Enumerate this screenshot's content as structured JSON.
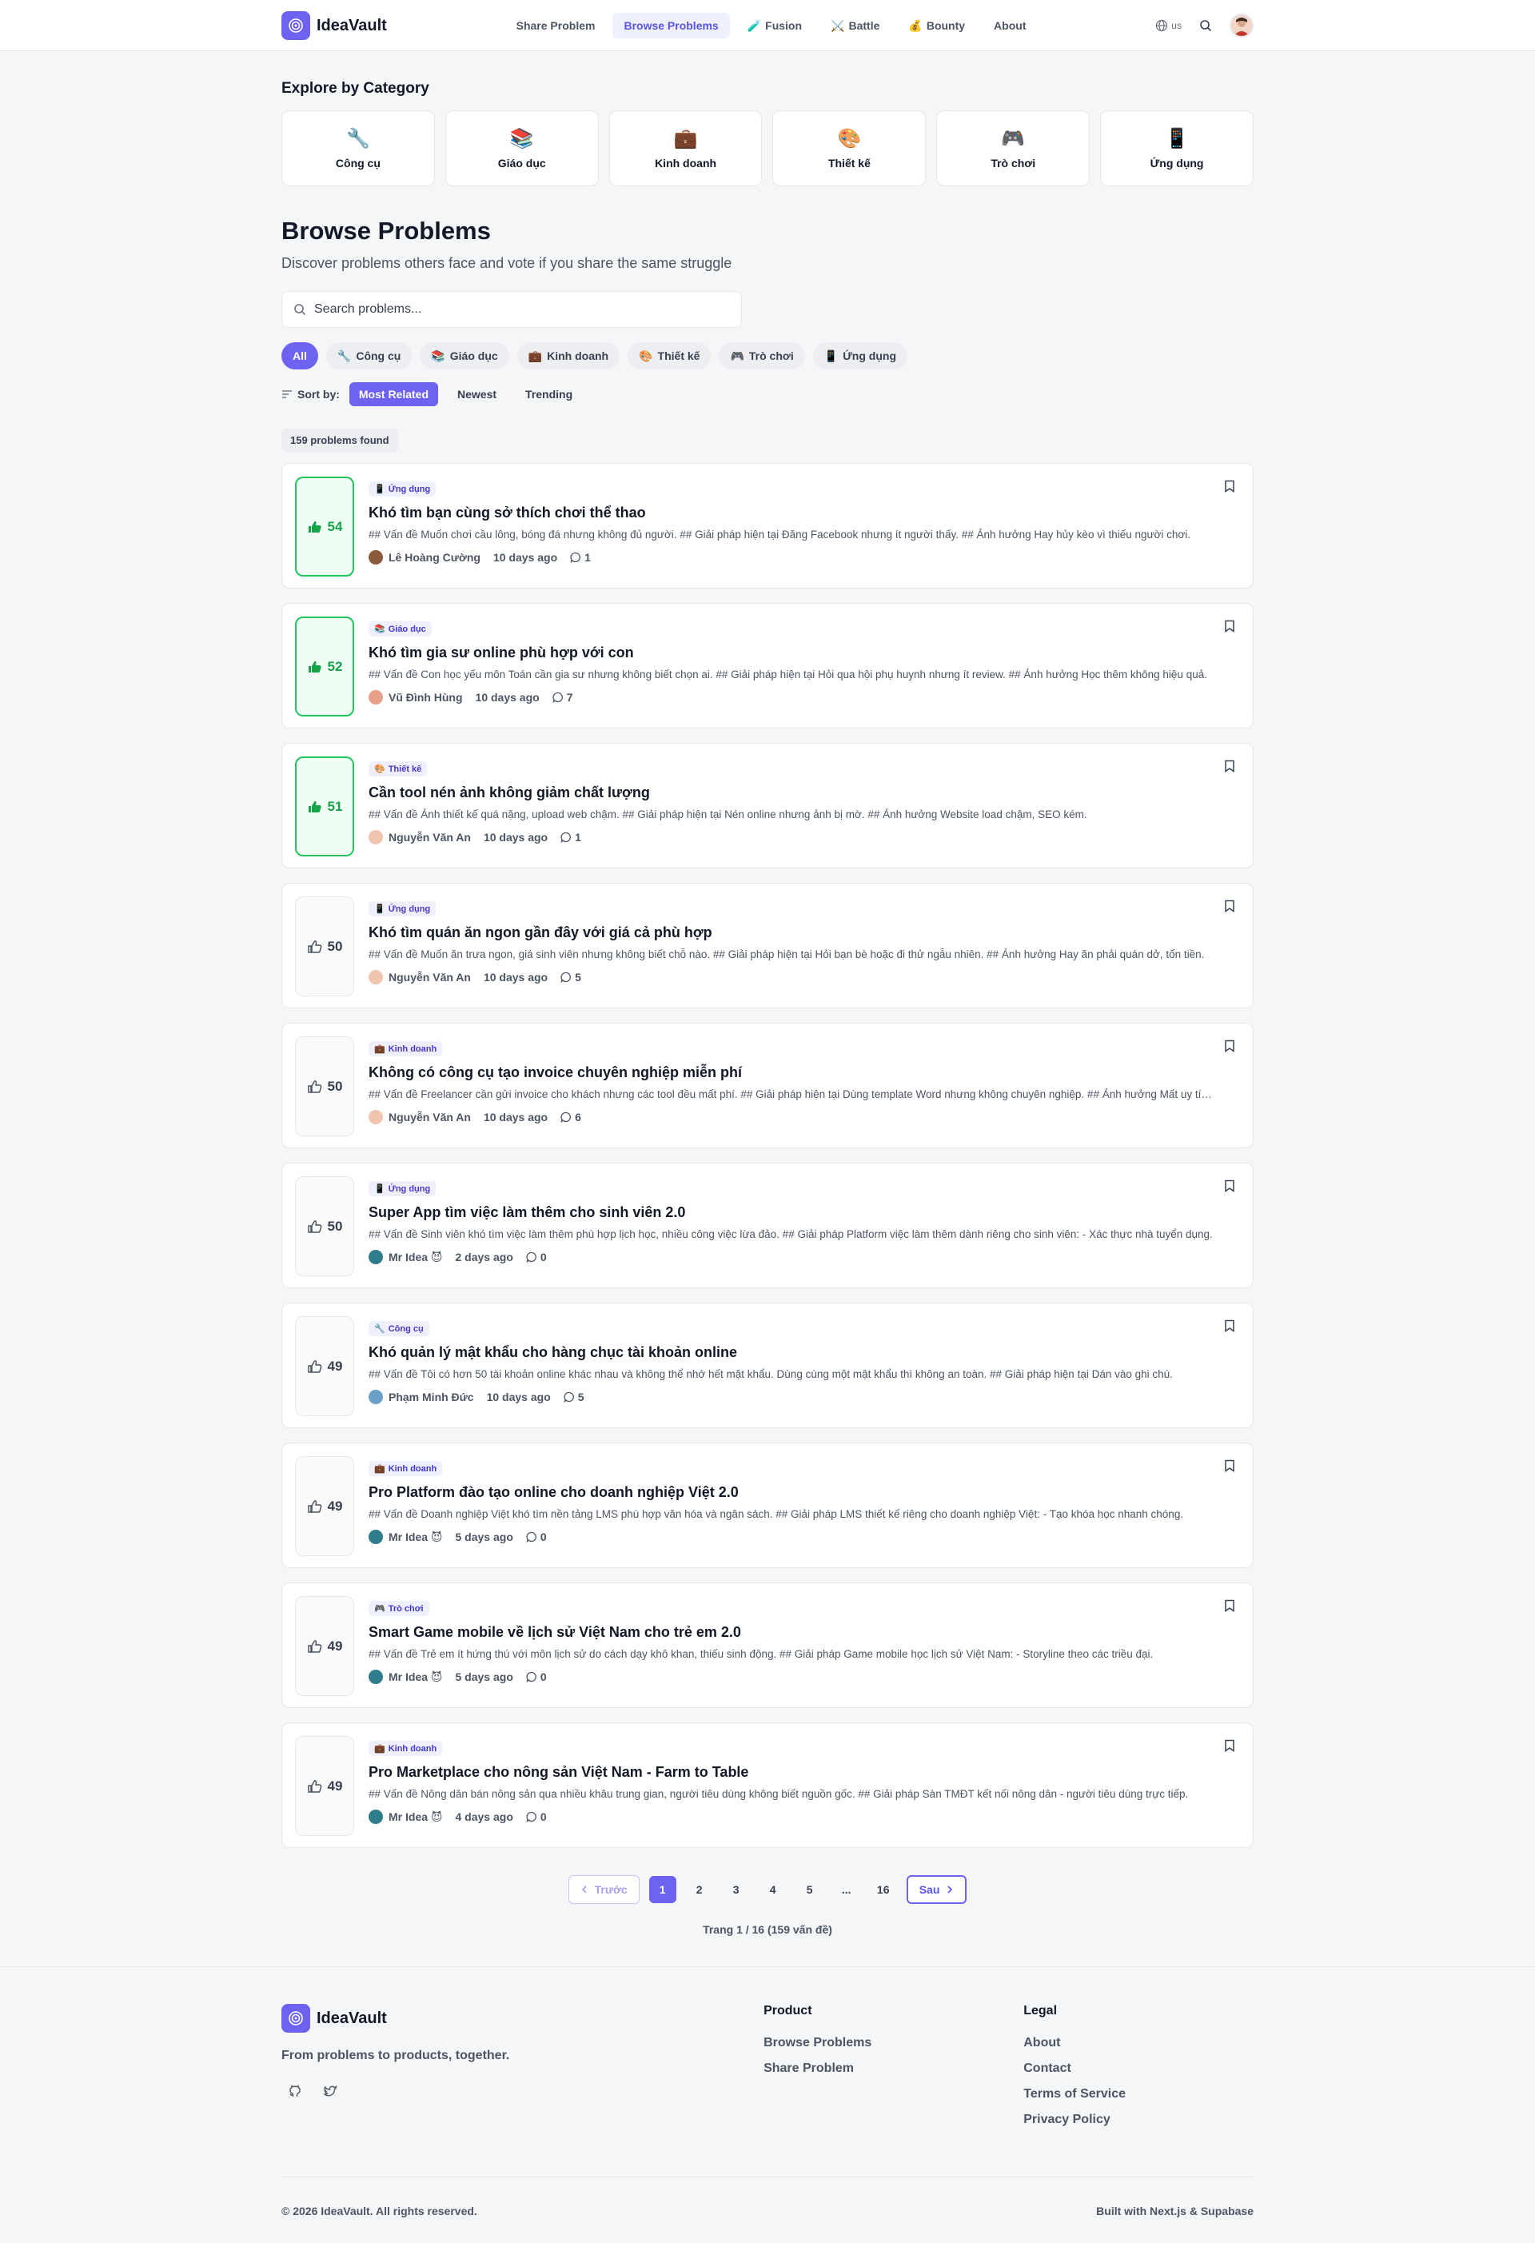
{
  "header": {
    "brand": "IdeaVault",
    "nav": [
      {
        "label": "Share Problem",
        "icon": ""
      },
      {
        "label": "Browse Problems",
        "icon": ""
      },
      {
        "label": "Fusion",
        "icon": "🧪"
      },
      {
        "label": "Battle",
        "icon": "⚔️"
      },
      {
        "label": "Bounty",
        "icon": "💰"
      },
      {
        "label": "About",
        "icon": ""
      }
    ],
    "lang": "us"
  },
  "categories_section": {
    "title": "Explore by Category",
    "items": [
      {
        "label": "Công cụ",
        "icon": "🔧"
      },
      {
        "label": "Giáo dục",
        "icon": "📚"
      },
      {
        "label": "Kinh doanh",
        "icon": "💼"
      },
      {
        "label": "Thiết kế",
        "icon": "🎨"
      },
      {
        "label": "Trò chơi",
        "icon": "🎮"
      },
      {
        "label": "Ứng dụng",
        "icon": "📱"
      }
    ]
  },
  "main": {
    "title": "Browse Problems",
    "subtitle": "Discover problems others face and vote if you share the same struggle",
    "search_placeholder": "Search problems...",
    "filters": [
      {
        "label": "All",
        "icon": ""
      },
      {
        "label": "Công cụ",
        "icon": "🔧"
      },
      {
        "label": "Giáo dục",
        "icon": "📚"
      },
      {
        "label": "Kinh doanh",
        "icon": "💼"
      },
      {
        "label": "Thiết kế",
        "icon": "🎨"
      },
      {
        "label": "Trò chơi",
        "icon": "🎮"
      },
      {
        "label": "Ứng dụng",
        "icon": "📱"
      }
    ],
    "sort_label": "Sort by:",
    "sort_options": [
      "Most Related",
      "Newest",
      "Trending"
    ],
    "count_text": "159 problems found"
  },
  "problems": [
    {
      "votes": "54",
      "voted": true,
      "tag": "Ứng dụng",
      "tag_icon": "📱",
      "title": "Khó tìm bạn cùng sở thích chơi thể thao",
      "desc": "## Vấn đề Muốn chơi cầu lông, bóng đá nhưng không đủ người. ## Giải pháp hiện tại Đăng Facebook nhưng ít người thấy. ## Ảnh hưởng Hay hủy kèo vì thiếu người chơi.",
      "author": "Lê Hoàng Cường",
      "avatar_color": "#8b5a3c",
      "time": "10 days ago",
      "comments": "1"
    },
    {
      "votes": "52",
      "voted": true,
      "tag": "Giáo dục",
      "tag_icon": "📚",
      "title": "Khó tìm gia sư online phù hợp với con",
      "desc": "## Vấn đề Con học yếu môn Toán cần gia sư nhưng không biết chọn ai. ## Giải pháp hiện tại Hỏi qua hội phụ huynh nhưng ít review. ## Ảnh hưởng Học thêm không hiệu quả.",
      "author": "Vũ Đình Hùng",
      "avatar_color": "#e8a08a",
      "time": "10 days ago",
      "comments": "7"
    },
    {
      "votes": "51",
      "voted": true,
      "tag": "Thiết kế",
      "tag_icon": "🎨",
      "title": "Cần tool nén ảnh không giảm chất lượng",
      "desc": "## Vấn đề Ảnh thiết kế quá nặng, upload web chậm. ## Giải pháp hiện tại Nén online nhưng ảnh bị mờ. ## Ảnh hưởng Website load chậm, SEO kém.",
      "author": "Nguyễn Văn An",
      "avatar_color": "#f1c4b0",
      "time": "10 days ago",
      "comments": "1"
    },
    {
      "votes": "50",
      "voted": false,
      "tag": "Ứng dụng",
      "tag_icon": "📱",
      "title": "Khó tìm quán ăn ngon gần đây với giá cả phù hợp",
      "desc": "## Vấn đề Muốn ăn trưa ngon, giá sinh viên nhưng không biết chỗ nào. ## Giải pháp hiện tại Hỏi bạn bè hoặc đi thử ngẫu nhiên. ## Ảnh hưởng Hay ăn phải quán dở, tốn tiền.",
      "author": "Nguyễn Văn An",
      "avatar_color": "#f1c4b0",
      "time": "10 days ago",
      "comments": "5"
    },
    {
      "votes": "50",
      "voted": false,
      "tag": "Kinh doanh",
      "tag_icon": "💼",
      "title": "Không có công cụ tạo invoice chuyên nghiệp miễn phí",
      "desc": "## Vấn đề Freelancer cần gửi invoice cho khách nhưng các tool đều mất phí. ## Giải pháp hiện tại Dùng template Word nhưng không chuyên nghiệp. ## Ảnh hưởng Mất uy tín với khách hàng.",
      "author": "Nguyễn Văn An",
      "avatar_color": "#f1c4b0",
      "time": "10 days ago",
      "comments": "6"
    },
    {
      "votes": "50",
      "voted": false,
      "tag": "Ứng dụng",
      "tag_icon": "📱",
      "title": "Super App tìm việc làm thêm cho sinh viên 2.0",
      "desc": "## Vấn đề Sinh viên khó tìm việc làm thêm phù hợp lịch học, nhiều công việc lừa đảo. ## Giải pháp Platform việc làm thêm dành riêng cho sinh viên: - Xác thực nhà tuyển dụng.",
      "author": "Mr Idea 😈",
      "avatar_color": "#2f7d8c",
      "time": "2 days ago",
      "comments": "0"
    },
    {
      "votes": "49",
      "voted": false,
      "tag": "Công cụ",
      "tag_icon": "🔧",
      "title": "Khó quản lý mật khẩu cho hàng chục tài khoản online",
      "desc": "## Vấn đề Tôi có hơn 50 tài khoản online khác nhau và không thể nhớ hết mật khẩu. Dùng cùng một mật khẩu thì không an toàn. ## Giải pháp hiện tại Dán vào ghi chú.",
      "author": "Phạm Minh Đức",
      "avatar_color": "#6aa0c8",
      "time": "10 days ago",
      "comments": "5"
    },
    {
      "votes": "49",
      "voted": false,
      "tag": "Kinh doanh",
      "tag_icon": "💼",
      "title": "Pro Platform đào tạo online cho doanh nghiệp Việt 2.0",
      "desc": "## Vấn đề Doanh nghiệp Việt khó tìm nền tảng LMS phù hợp văn hóa và ngân sách. ## Giải pháp LMS thiết kế riêng cho doanh nghiệp Việt: - Tạo khóa học nhanh chóng.",
      "author": "Mr Idea 😈",
      "avatar_color": "#2f7d8c",
      "time": "5 days ago",
      "comments": "0"
    },
    {
      "votes": "49",
      "voted": false,
      "tag": "Trò chơi",
      "tag_icon": "🎮",
      "title": "Smart Game mobile về lịch sử Việt Nam cho trẻ em 2.0",
      "desc": "## Vấn đề Trẻ em ít hứng thú với môn lịch sử do cách dạy khô khan, thiếu sinh động. ## Giải pháp Game mobile học lịch sử Việt Nam: - Storyline theo các triều đại.",
      "author": "Mr Idea 😈",
      "avatar_color": "#2f7d8c",
      "time": "5 days ago",
      "comments": "0"
    },
    {
      "votes": "49",
      "voted": false,
      "tag": "Kinh doanh",
      "tag_icon": "💼",
      "title": "Pro Marketplace cho nông sản Việt Nam - Farm to Table",
      "desc": "## Vấn đề Nông dân bán nông sản qua nhiều khâu trung gian, người tiêu dùng không biết nguồn gốc. ## Giải pháp Sàn TMĐT kết nối nông dân - người tiêu dùng trực tiếp.",
      "author": "Mr Idea 😈",
      "avatar_color": "#2f7d8c",
      "time": "4 days ago",
      "comments": "0"
    }
  ],
  "pagination": {
    "prev": "Trước",
    "next": "Sau",
    "pages": [
      "1",
      "2",
      "3",
      "4",
      "5",
      "...",
      "16"
    ],
    "current": "1",
    "info": "Trang 1 / 16 (159 vấn đề)"
  },
  "footer": {
    "brand": "IdeaVault",
    "tagline": "From problems to products, together.",
    "columns": [
      {
        "title": "Product",
        "links": [
          "Browse Problems",
          "Share Problem"
        ]
      },
      {
        "title": "Legal",
        "links": [
          "About",
          "Contact",
          "Terms of Service",
          "Privacy Policy"
        ]
      }
    ],
    "copyright": "© 2026 IdeaVault. All rights reserved.",
    "built_with": "Built with Next.js & Supabase"
  },
  "colors": {
    "accent": "#6d63f0",
    "upvote": "#16a34a"
  }
}
